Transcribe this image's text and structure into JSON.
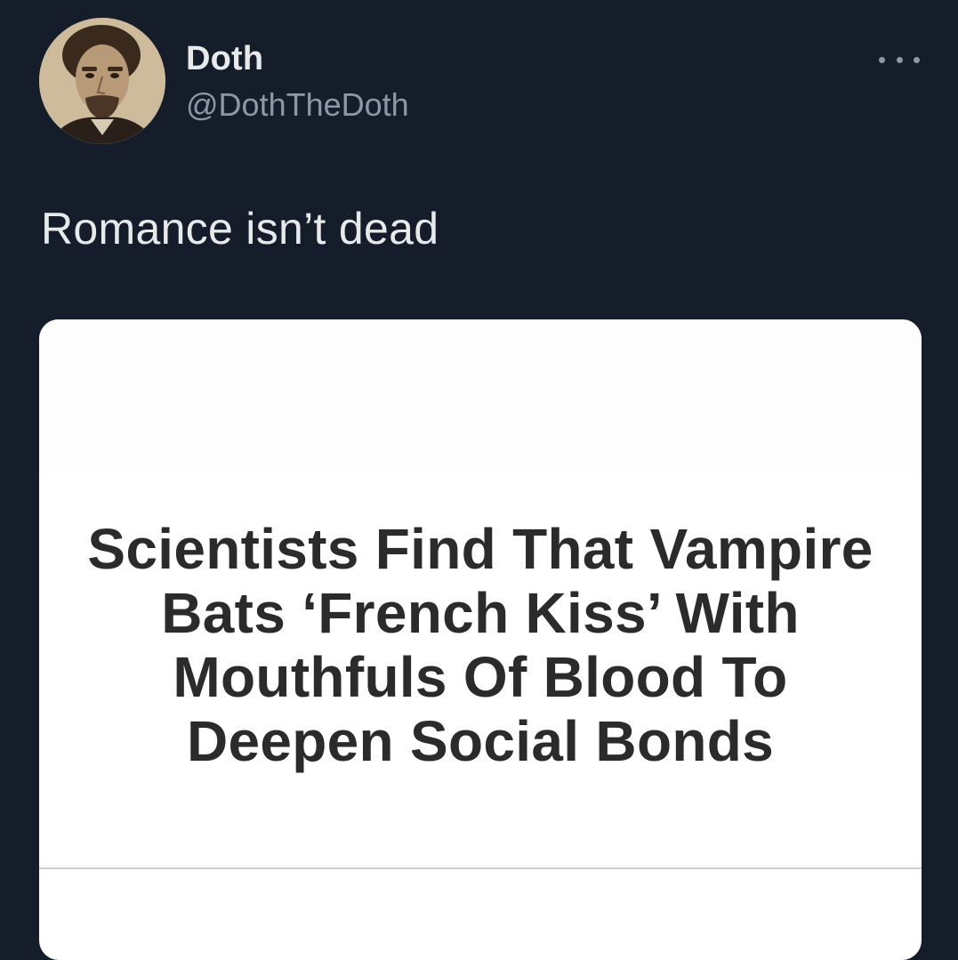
{
  "tweet": {
    "author": {
      "display_name": "Doth",
      "handle": "@DothTheDoth",
      "avatar_icon": "portrait-avatar"
    },
    "more_icon": "more-horizontal-icon",
    "text": "Romance isn’t dead",
    "card": {
      "headline": "Scientists Find That Vampire Bats ‘French Kiss’ With Mouthfuls Of Blood To Deepen Social Bonds"
    }
  },
  "colors": {
    "background": "#151d2b",
    "primary_text": "#e7e9ea",
    "secondary_text": "#8b98a5",
    "card_background": "#ffffff",
    "headline_text": "#2b2b2b"
  }
}
